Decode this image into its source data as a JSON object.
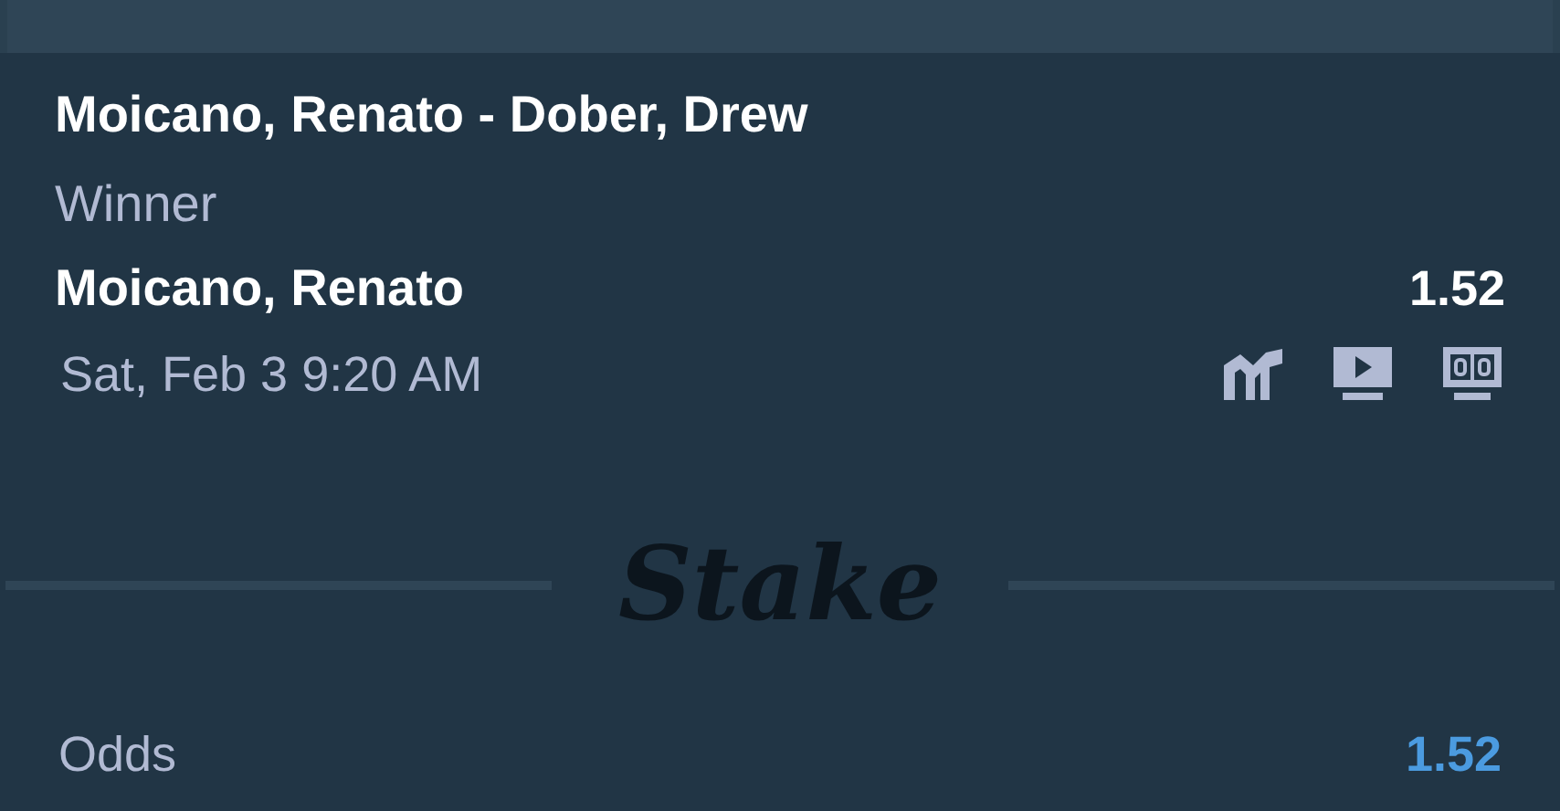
{
  "event": {
    "title": "Moicano, Renato - Dober, Drew",
    "market": "Winner",
    "selection": "Moicano, Renato",
    "price": "1.52",
    "datetime": "Sat, Feb 3 9:20 AM"
  },
  "logo": "Stake",
  "summary": {
    "label": "Odds",
    "value": "1.52"
  }
}
